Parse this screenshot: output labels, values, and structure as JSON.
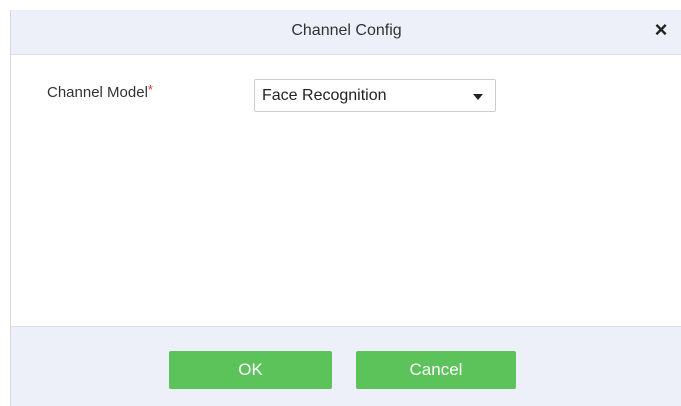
{
  "dialog": {
    "title": "Channel Config",
    "close_glyph": "×"
  },
  "form": {
    "channel_model_label": "Channel Model",
    "required_mark": "*",
    "channel_model_value": "Face Recognition"
  },
  "footer": {
    "ok_label": "OK",
    "cancel_label": "Cancel"
  },
  "colors": {
    "header_bg": "#eef0f9",
    "button_green": "#5cc25a",
    "required_red": "#e0302e"
  },
  "icons": {
    "close": "close-icon",
    "dropdown": "chevron-down-icon"
  }
}
